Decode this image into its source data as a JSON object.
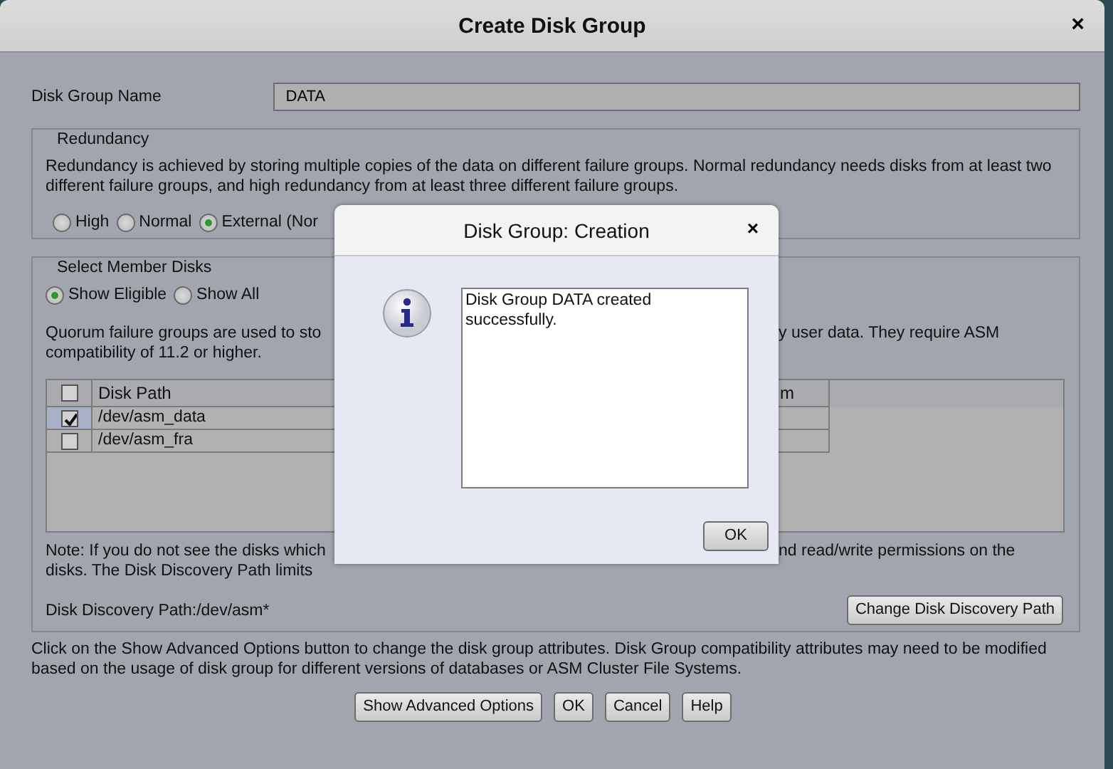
{
  "window": {
    "title": "Create Disk Group",
    "close": "×"
  },
  "disk_group_name": {
    "label": "Disk Group Name",
    "value": "DATA"
  },
  "redundancy": {
    "legend": "Redundancy",
    "description": "Redundancy is achieved by storing multiple copies of the data on different failure groups. Normal redundancy needs disks from at least two different failure groups, and high redundancy from at least three different failure groups.",
    "options": [
      {
        "label": "High",
        "selected": false
      },
      {
        "label": "Normal",
        "selected": false
      },
      {
        "label": "External (Nor",
        "selected": true
      }
    ]
  },
  "member_disks": {
    "legend": "Select Member Disks",
    "filters": [
      {
        "label": "Show Eligible",
        "selected": true
      },
      {
        "label": "Show All",
        "selected": false
      }
    ],
    "quorum_lines": [
      {
        "left": "Quorum failure groups are used to sto",
        "right": "y user data. They require ASM"
      },
      {
        "left": "compatibility of 11.2 or higher."
      }
    ],
    "table": {
      "columns": [
        {
          "kind": "checkbox",
          "checked": false
        },
        {
          "kind": "text",
          "label": "Disk Path"
        },
        {
          "kind": "text",
          "label": "m"
        }
      ],
      "rows": [
        {
          "checked": true,
          "selected": true,
          "path": "/dev/asm_data"
        },
        {
          "checked": false,
          "selected": false,
          "path": "/dev/asm_fra"
        }
      ]
    },
    "note_lines": [
      {
        "left": "Note: If you do not see the disks which",
        "right": "nd read/write permissions on the"
      },
      {
        "left": "disks. The Disk Discovery Path limits"
      }
    ],
    "discovery_path": "Disk Discovery Path:/dev/asm*",
    "change_button": "Change Disk Discovery Path"
  },
  "footer_text": "Click on the Show Advanced Options button to change the disk group attributes. Disk Group compatibility attributes may need to be modified based on the usage of disk group for different versions of databases or ASM Cluster File Systems.",
  "buttons": [
    "Show Advanced Options",
    "OK",
    "Cancel",
    "Help"
  ],
  "message_dialog": {
    "title": "Disk Group: Creation",
    "close": "×",
    "message": "Disk Group DATA created successfully.",
    "button": "OK"
  }
}
